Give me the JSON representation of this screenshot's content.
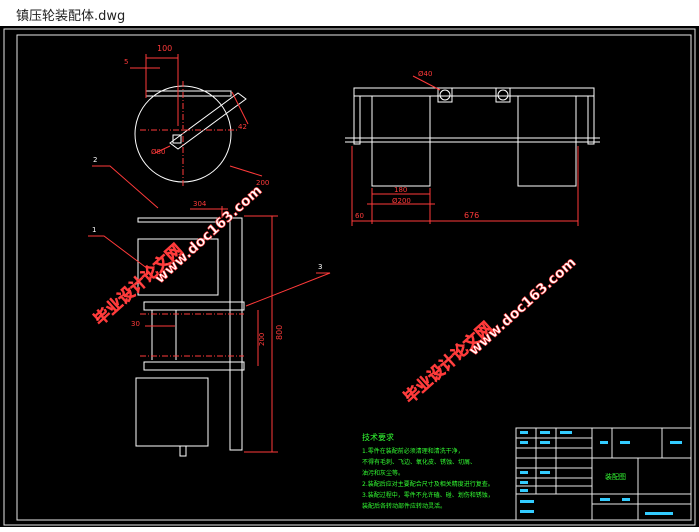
{
  "window": {
    "title": "镇压轮装配体.dwg"
  },
  "drawing": {
    "dims": {
      "d100": "100",
      "d5": "5",
      "d42": "42",
      "phi80": "Ø80",
      "d200": "200",
      "phi40": "Ø40",
      "d180": "180",
      "phi200": "Ø200",
      "d60": "60",
      "d676": "676",
      "d304": "304",
      "d800": "800",
      "d200b": "200",
      "d30": "30"
    },
    "balloons": {
      "b1": "1",
      "b2": "2",
      "b3": "3"
    },
    "tech_req": {
      "title": "技术要求",
      "lines": [
        "1.零件在装配前必须清理和清洗干净，",
        "  不得有毛刺、飞边、氧化皮、锈蚀、切屑、",
        "  油污和灰尘等。",
        "2.装配后应对主要配合尺寸及相关精度进行复查。",
        "3.装配过程中，零件不允许磕、碰、划伤和锈蚀，",
        "  装配后各转动部件应转动灵活。"
      ]
    },
    "title_block": {
      "name": "装配图"
    },
    "watermarks": [
      {
        "text": "毕业设计论文网"
      },
      {
        "text": "www.doc163.com"
      }
    ]
  }
}
